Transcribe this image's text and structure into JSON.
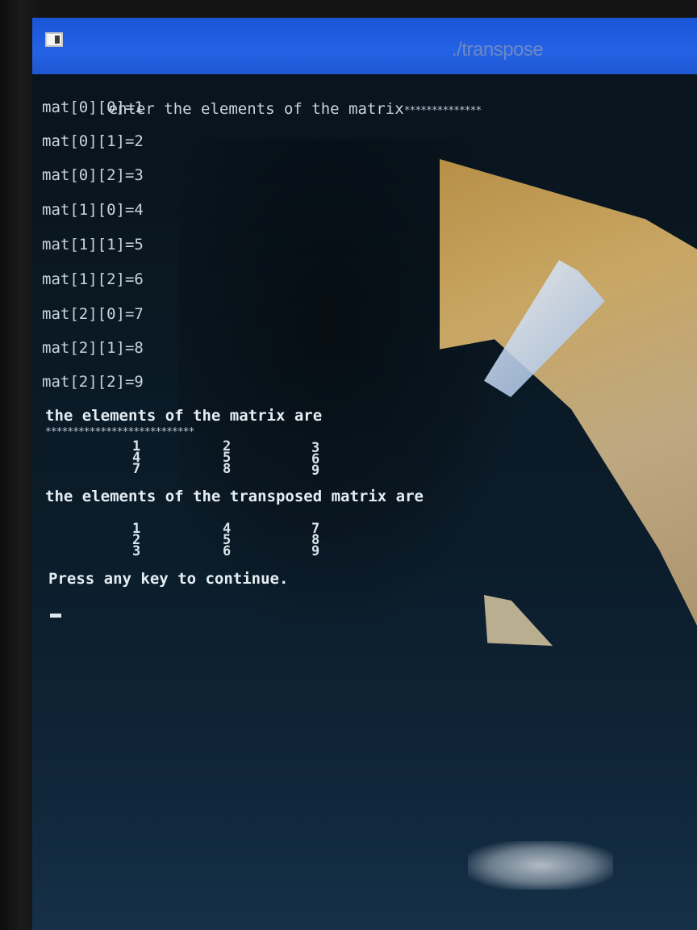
{
  "window": {
    "title": "./transpose"
  },
  "console": {
    "prompt": "enter the elements of the matrix",
    "prompt_stars": "**************",
    "inputs": [
      "mat[0][0]=1",
      "mat[0][1]=2",
      "mat[0][2]=3",
      "mat[1][0]=4",
      "mat[1][1]=5",
      "mat[1][2]=6",
      "mat[2][0]=7",
      "mat[2][1]=8",
      "mat[2][2]=9"
    ],
    "matrix_heading": "the elements of the matrix are",
    "matrix_stars": "***************************",
    "matrix": [
      [
        "1",
        "2",
        "3"
      ],
      [
        "4",
        "5",
        "6"
      ],
      [
        "7",
        "8",
        "9"
      ]
    ],
    "transposed_heading": "the elements of the transposed matrix are",
    "transposed": [
      [
        "1",
        "4",
        "7"
      ],
      [
        "2",
        "5",
        "8"
      ],
      [
        "3",
        "6",
        "9"
      ]
    ],
    "footer": "Press any key to continue."
  },
  "colors": {
    "titlebar": "#2462e6",
    "console_text": "#c9d4dd",
    "console_bg": "#0a1822"
  }
}
